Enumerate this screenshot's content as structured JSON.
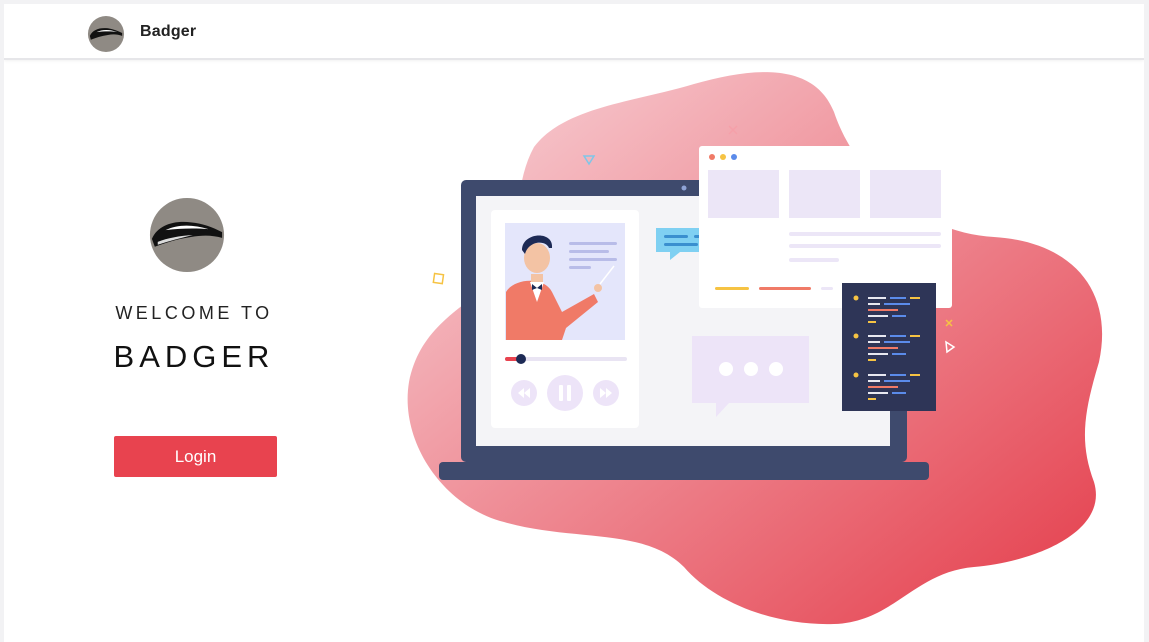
{
  "header": {
    "brand": "Badger"
  },
  "hero": {
    "welcome": "WELCOME TO",
    "app_name": "BADGER",
    "login_label": "Login"
  },
  "colors": {
    "accent": "#e8434f",
    "laptop_frame": "#3e4a6d",
    "chat_bubble": "#7fd0f2"
  },
  "icons": [
    "badger-logo-icon",
    "rewind-icon",
    "pause-icon",
    "fast-forward-icon",
    "sparkle-icon"
  ]
}
